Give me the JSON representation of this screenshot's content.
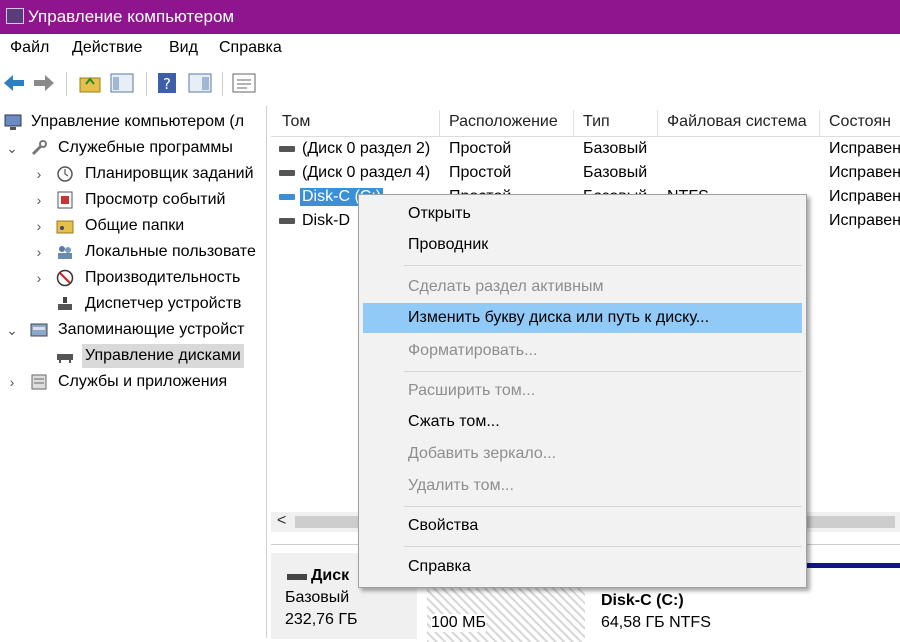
{
  "window": {
    "title": "Управление компьютером"
  },
  "menu": [
    "Файл",
    "Действие",
    "Вид",
    "Справка"
  ],
  "tree": {
    "root": "Управление компьютером (л",
    "system_tools": "Служебные программы",
    "task_scheduler": "Планировщик заданий",
    "event_viewer": "Просмотр событий",
    "shared_folders": "Общие папки",
    "local_users": "Локальные пользовате",
    "performance": "Производительность",
    "device_manager": "Диспетчер устройств",
    "storage": "Запоминающие устройст",
    "disk_management": "Управление дисками",
    "services_apps": "Службы и приложения"
  },
  "columns": [
    "Том",
    "Расположение",
    "Тип",
    "Файловая система",
    "Состоян"
  ],
  "volumes": [
    {
      "name": "(Диск 0 раздел 2)",
      "layout": "Простой",
      "type": "Базовый",
      "fs": "",
      "status": "Исправен"
    },
    {
      "name": "(Диск 0 раздел 4)",
      "layout": "Простой",
      "type": "Базовый",
      "fs": "",
      "status": "Исправен"
    },
    {
      "name": "Disk-C (C:)",
      "layout": "Простой",
      "type": "Базовый",
      "fs": "NTFS",
      "status": "Исправен"
    },
    {
      "name": "Disk-D",
      "layout": "",
      "type": "",
      "fs": "",
      "status": "Исправен"
    }
  ],
  "scroll": {
    "left_arrow": "<"
  },
  "disk_panel": {
    "name": "Диск",
    "type": "Базовый",
    "size": "232,76 ГБ",
    "part1_size": "100 МБ",
    "part2_name": "Disk-C (C:)",
    "part2_size": "64,58 ГБ NTFS"
  },
  "context_menu": {
    "open": "Открыть",
    "explorer": "Проводник",
    "make_active": "Сделать раздел активным",
    "change_letter": "Изменить букву диска или путь к диску...",
    "format": "Форматировать...",
    "extend": "Расширить том...",
    "shrink": "Сжать том...",
    "add_mirror": "Добавить зеркало...",
    "delete": "Удалить том...",
    "properties": "Свойства",
    "help": "Справка"
  },
  "colors": {
    "titlebar": "#8e158e",
    "highlight": "#91c9f7",
    "selection": "#3b8fd6",
    "disk_bar": "#14148a"
  }
}
